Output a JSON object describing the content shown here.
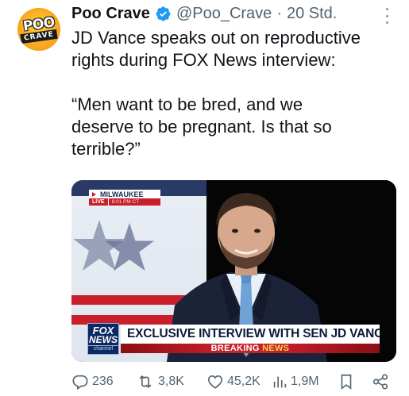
{
  "author": {
    "name": "Poo Crave",
    "handle": "@Poo_Crave",
    "separator": "·",
    "time": "20 Std.",
    "avatar_text_top": "POO",
    "avatar_text_bottom": "CRAVE",
    "verified_color": "#1d9bf0"
  },
  "tweet": {
    "line1": "JD Vance speaks out on reproductive",
    "line2": "rights during FOX News interview:",
    "quote1": "“Men want to be bred, and we",
    "quote2": "deserve to be pregnant. Is that so",
    "quote3": "terrible?”"
  },
  "media": {
    "locator_city": "MILWAUKEE",
    "locator_live": "LIVE",
    "locator_time": "8:01 PM CT",
    "network_line1": "FOX",
    "network_line2": "NEWS",
    "network_line3": "channel",
    "headline": "EXCLUSIVE INTERVIEW WITH SEN JD VANCE",
    "breaking_word1": "BREAKING",
    "breaking_word2": "NEWS"
  },
  "actions": {
    "reply_icon": "reply-icon",
    "reply_count": "236",
    "retweet_icon": "retweet-icon",
    "retweet_count": "3,8K",
    "like_icon": "heart-icon",
    "like_count": "45,2K",
    "views_icon": "views-icon",
    "views_count": "1,9M",
    "bookmark_icon": "bookmark-icon",
    "share_icon": "share-icon"
  },
  "colors": {
    "text": "#0f1419",
    "muted": "#536471",
    "fox_red": "#c8202a",
    "fox_navy": "#0b2a63"
  }
}
